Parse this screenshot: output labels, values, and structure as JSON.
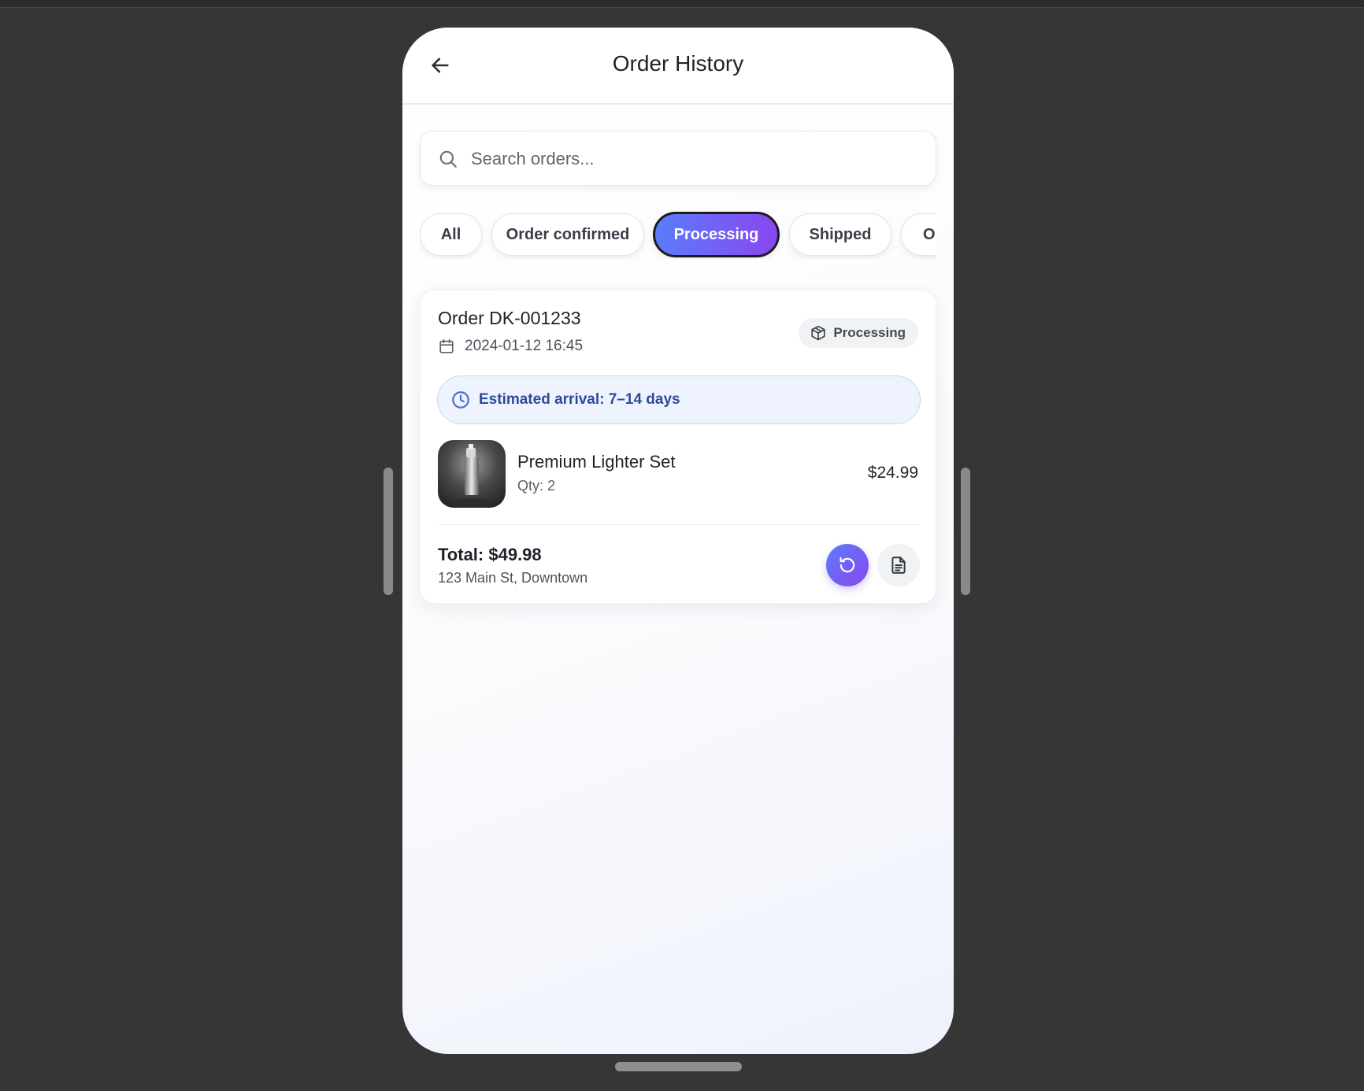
{
  "header": {
    "title": "Order History",
    "back_icon": "arrow-left-icon"
  },
  "search": {
    "placeholder": "Search orders...",
    "value": "",
    "icon": "search-icon"
  },
  "filters": {
    "selected": "Processing",
    "chips": [
      "All",
      "Order confirmed",
      "Processing",
      "Shipped",
      "O"
    ]
  },
  "orders": [
    {
      "id_label": "Order DK-001233",
      "datetime": "2024-01-12 16:45",
      "status": "Processing",
      "status_icon": "package-icon",
      "eta_label": "Estimated arrival: 7–14 days",
      "items": [
        {
          "name": "Premium Lighter Set",
          "qty_label": "Qty: 2",
          "price": "$24.99"
        }
      ],
      "total_label": "Total: $49.98",
      "address": "123 Main St, Downtown"
    }
  ],
  "colors": {
    "accent_start": "#5b7cfa",
    "accent_end": "#8a46f0",
    "eta_text": "#2e4a9a",
    "background": "#363636"
  }
}
